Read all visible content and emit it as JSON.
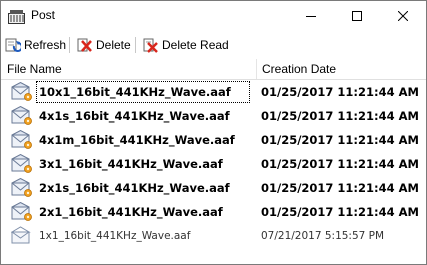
{
  "window": {
    "title": "Post",
    "icon": "mailbox-icon"
  },
  "toolbar": {
    "refresh_label": "Refresh",
    "delete_label": "Delete",
    "delete_read_label": "Delete Read"
  },
  "columns": {
    "file_name": "File Name",
    "creation_date": "Creation Date"
  },
  "rows": [
    {
      "name": "10x1_16bit_441KHz_Wave.aaf",
      "date": "01/25/2017 11:21:44 AM",
      "unread": true
    },
    {
      "name": "4x1s_16bit_441KHz_Wave.aaf",
      "date": "01/25/2017 11:21:44 AM",
      "unread": true
    },
    {
      "name": "4x1m_16bit_441KHz_Wave.aaf",
      "date": "01/25/2017 11:21:44 AM",
      "unread": true
    },
    {
      "name": "3x1_16bit_441KHz_Wave.aaf",
      "date": "01/25/2017 11:21:44 AM",
      "unread": true
    },
    {
      "name": "2x1s_16bit_441KHz_Wave.aaf",
      "date": "01/25/2017 11:21:44 AM",
      "unread": true
    },
    {
      "name": "2x1_16bit_441KHz_Wave.aaf",
      "date": "01/25/2017 11:21:44 AM",
      "unread": true
    },
    {
      "name": "1x1_16bit_441KHz_Wave.aaf",
      "date": "07/21/2017 5:15:57 PM",
      "unread": false
    }
  ],
  "colors": {
    "accent": "#1e5bbf",
    "delete_red": "#d9261c",
    "badge_orange": "#f0a020"
  }
}
